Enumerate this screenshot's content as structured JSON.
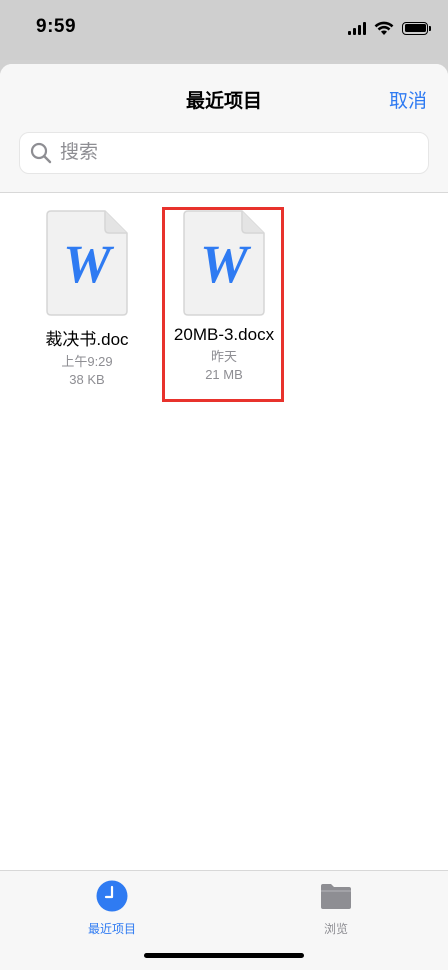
{
  "status_bar": {
    "time": "9:59"
  },
  "header": {
    "title": "最近项目",
    "cancel_label": "取消"
  },
  "search": {
    "placeholder": "搜索",
    "value": ""
  },
  "files": [
    {
      "name": "裁决书.doc",
      "date": "上午9:29",
      "size": "38 KB",
      "icon": "word-doc-icon",
      "selected": false
    },
    {
      "name": "20MB-3.docx",
      "date": "昨天",
      "size": "21 MB",
      "icon": "word-doc-icon",
      "selected": true
    }
  ],
  "doc_icon_letter": "W",
  "tabs": [
    {
      "label": "最近项目",
      "icon": "clock-icon",
      "active": true
    },
    {
      "label": "浏览",
      "icon": "folder-icon",
      "active": false
    }
  ],
  "colors": {
    "accent": "#2f7bf2",
    "highlight": "#e8322c",
    "secondary_text": "#8e8e93"
  }
}
